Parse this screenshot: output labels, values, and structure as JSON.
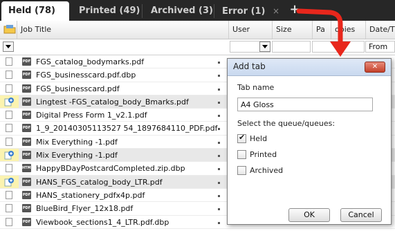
{
  "tabs": [
    {
      "label": "Held (78)",
      "active": true
    },
    {
      "label": "Printed (49)",
      "active": false
    },
    {
      "label": "Archived (3)",
      "active": false
    },
    {
      "label": "Error (1)",
      "active": false,
      "close": "×"
    }
  ],
  "add_tab_label": "+",
  "columns": {
    "job_title": "Job Title",
    "user": "User",
    "size": "Size",
    "pages": "Pa",
    "copies": "opies",
    "date_time": "Date/Tim"
  },
  "filter": {
    "date_from": "From"
  },
  "rows": [
    {
      "name": "FGS_catalog_bodymarks.pdf",
      "type": "PDF",
      "icon": "page-icon",
      "selected": false,
      "highlight": false
    },
    {
      "name": "FGS_businesscard.pdf.dbp",
      "type": "PDF",
      "icon": "page-icon",
      "selected": false,
      "highlight": false
    },
    {
      "name": "FGS_businesscard.pdf",
      "type": "PDF",
      "icon": "page-icon",
      "selected": false,
      "highlight": false
    },
    {
      "name": "Lingtest -FGS_catalog_body_Bmarks.pdf",
      "type": "PDF",
      "icon": "imposed-job-icon",
      "selected": true,
      "highlight": true
    },
    {
      "name": "Digital Press Form 1_v2.1.pdf",
      "type": "PDF",
      "icon": "page-icon",
      "selected": false,
      "highlight": false
    },
    {
      "name": "1_9_20140305113527 54_1897684110_PDF.pdf",
      "type": "PDF",
      "icon": "page-icon",
      "selected": false,
      "highlight": false
    },
    {
      "name": "Mix Everything -1.pdf",
      "type": "PDF",
      "icon": "page-icon",
      "selected": false,
      "highlight": false
    },
    {
      "name": "Mix Everything -1.pdf",
      "type": "PDF",
      "icon": "imposed-job-icon",
      "selected": true,
      "highlight": true
    },
    {
      "name": "HappyBDayPostcardCompleted.zip.dbp",
      "type": "HTML",
      "icon": "page-icon",
      "selected": false,
      "highlight": false
    },
    {
      "name": "HANS_FGS_catalog_body_LTR.pdf",
      "type": "PDF",
      "icon": "imposed-job-icon",
      "selected": true,
      "highlight": true
    },
    {
      "name": "HANS_stationery_pdfx4p.pdf",
      "type": "PDF",
      "icon": "page-icon",
      "selected": false,
      "highlight": false
    },
    {
      "name": "BlueBird_Flyer_12x18.pdf",
      "type": "PDF",
      "icon": "page-icon",
      "selected": false,
      "highlight": false
    },
    {
      "name": "Viewbook_sections1_4_LTR.pdf.dbp",
      "type": "PDF",
      "icon": "page-icon",
      "selected": false,
      "highlight": false
    }
  ],
  "dialog": {
    "title": "Add tab",
    "close": "✕",
    "tab_name_label": "Tab name",
    "tab_name_value": "A4 Gloss",
    "queue_label": "Select the queue/queues:",
    "queues": [
      {
        "label": "Held",
        "checked": true
      },
      {
        "label": "Printed",
        "checked": false
      },
      {
        "label": "Archived",
        "checked": false
      }
    ],
    "ok": "OK",
    "cancel": "Cancel"
  },
  "colors": {
    "annotation_arrow": "#e8271c",
    "highlight": "#fbf3b0",
    "tabbar": "#272727"
  }
}
